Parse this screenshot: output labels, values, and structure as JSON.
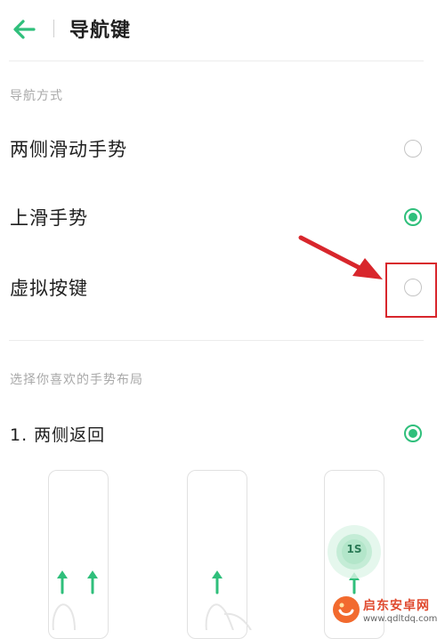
{
  "header": {
    "title": "导航键",
    "back_icon": "arrow-left-icon"
  },
  "section_nav": {
    "label": "导航方式",
    "options": [
      {
        "label": "两侧滑动手势",
        "selected": false
      },
      {
        "label": "上滑手势",
        "selected": true
      },
      {
        "label": "虚拟按键",
        "selected": false
      }
    ]
  },
  "section_layout": {
    "label": "选择你喜欢的手势布局",
    "options": [
      {
        "label": "1. 两侧返回",
        "selected": true
      }
    ],
    "preview_badge": "1S"
  },
  "annotation": {
    "arrow_color": "#d8262c",
    "box_color": "#d8262c"
  },
  "watermark": {
    "text": "启东安卓网",
    "url": "www.qdltdq.com"
  },
  "colors": {
    "accent": "#2fbf7b",
    "text": "#1f1f1f",
    "muted": "#a9a9a9"
  }
}
